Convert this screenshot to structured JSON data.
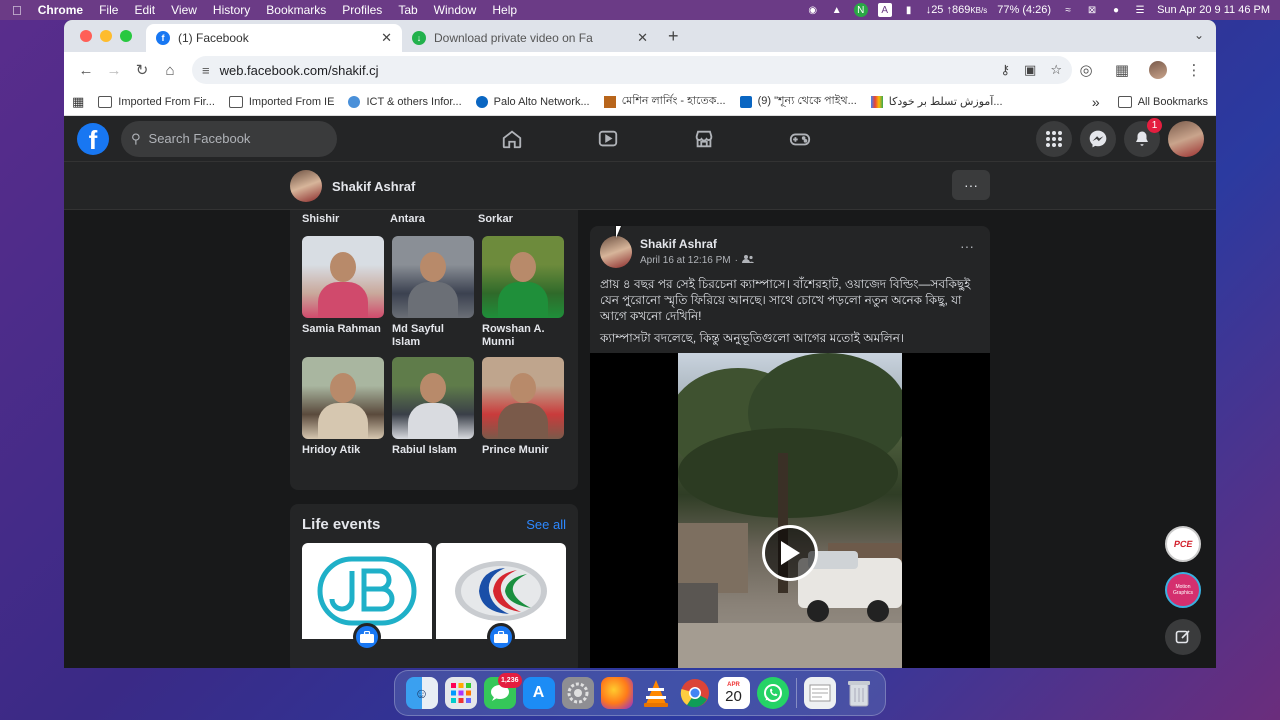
{
  "menubar": {
    "app": "Chrome",
    "items": [
      "File",
      "Edit",
      "View",
      "History",
      "Bookmarks",
      "Profiles",
      "Tab",
      "Window",
      "Help"
    ],
    "network": "↓25 ↑869",
    "network_unit": "KB/s",
    "battery": "77% (4:26)",
    "clock": "Sun Apr 20  9 11 46 PM"
  },
  "tabs": [
    {
      "title": "(1) Facebook",
      "active": true
    },
    {
      "title": "Download private video on Fa",
      "active": false
    }
  ],
  "address": {
    "url": "web.facebook.com/shakif.cj"
  },
  "bookmarks": {
    "items": [
      "Imported From Fir...",
      "Imported From IE",
      "ICT & others Infor...",
      "Palo Alto Network...",
      "মেশিন লার্নিং - হাতেক...",
      "(9) \"শূন্য থেকে পাইথ...",
      "آموزش تسلط بر خودکا..."
    ],
    "all": "All Bookmarks",
    "overflow": "»"
  },
  "facebook": {
    "search_placeholder": "Search Facebook",
    "notifications_count": "1",
    "profile_name": "Shakif Ashraf",
    "more": "···"
  },
  "friends": {
    "cut_names": [
      "Shishir",
      "Antara",
      "Sorkar"
    ],
    "list": [
      {
        "name": "Samia Rahman",
        "colors": [
          "#d8dde3",
          "#c9a89b",
          "#d04a6c"
        ]
      },
      {
        "name": "Md Sayful Islam",
        "colors": [
          "#8a8f96",
          "#3b4150",
          "#6b6f76"
        ]
      },
      {
        "name": "Rowshan A. Munni",
        "colors": [
          "#6d8b3c",
          "#2f6a2a",
          "#1f8f3a"
        ]
      },
      {
        "name": "Hridoy Atik",
        "colors": [
          "#a9b6a0",
          "#5a4a3c",
          "#d6c7b0"
        ]
      },
      {
        "name": "Rabiul Islam",
        "colors": [
          "#5f7c4a",
          "#3a3f48",
          "#d9dbe0"
        ]
      },
      {
        "name": "Prince Munir",
        "colors": [
          "#bfa58d",
          "#c93b3b",
          "#7a5a4a"
        ]
      }
    ]
  },
  "life_events": {
    "title": "Life events",
    "see_all": "See all"
  },
  "post": {
    "author": "Shakif Ashraf",
    "date": "April 16 at 12:16 PM",
    "separator": "·",
    "text1": "প্রায় ৪ বছর পর সেই চিরচেনা ক্যাম্পাসে। বাঁশেরহাট, ওয়াজেদ বিল্ডিং—সবকিছুই যেন পুরোনো স্মৃতি ফিরিয়ে আনছে। সাথে চোখে পড়লো নতুন অনেক কিছু, যা আগে কখনো দেখিনি!",
    "text2": "ক্যাম্পাসটা বদলেছে, কিন্তু অনুভূতিগুলো আগের মতোই অমলিন।",
    "more": "···"
  },
  "floating": {
    "pce": "PCE",
    "motion": "Motion Graphics"
  },
  "dock": {
    "messages_badge": "1,236",
    "calendar_month": "APR",
    "calendar_day": "20"
  },
  "colors": {
    "fb_blue": "#1877f2",
    "fb_dark": "#18191a",
    "fb_card": "#242526",
    "link": "#2d88ff"
  }
}
